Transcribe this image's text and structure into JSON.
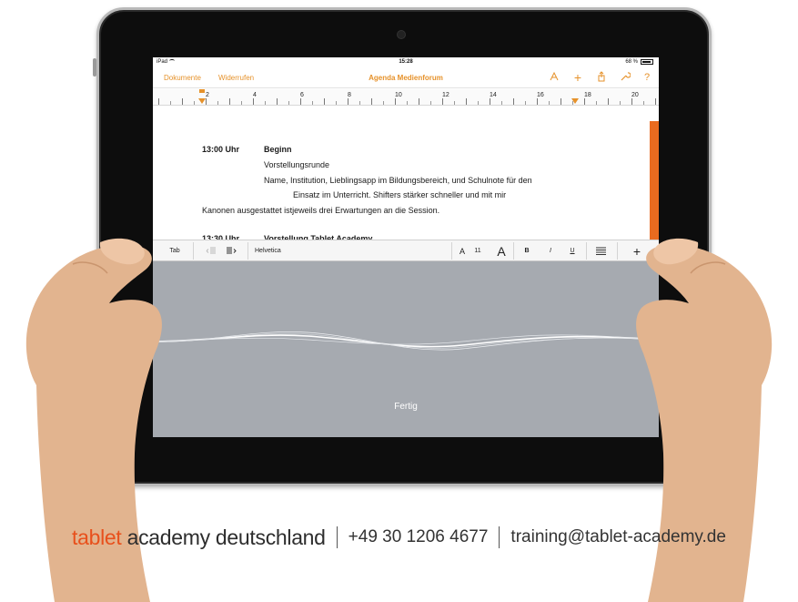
{
  "status": {
    "device": "iPad",
    "time": "15:28",
    "battery": "68 %"
  },
  "nav": {
    "documents": "Dokumente",
    "undo": "Widerrufen",
    "title": "Agenda Medienforum",
    "icons": [
      "brush-icon",
      "plus-icon",
      "share-icon",
      "wrench-icon",
      "help-icon"
    ],
    "help_glyph": "?",
    "plus_glyph": "+"
  },
  "ruler": {
    "numbers": [
      "2",
      "4",
      "6",
      "8",
      "10",
      "12",
      "14",
      "16",
      "18",
      "20"
    ]
  },
  "document": {
    "time1": "13:00 Uhr",
    "heading1": "Beginn",
    "line1": "Vorstellungsrunde",
    "line2": "Name, Institution, Lieblingsapp im Bildungsbereich, und Schulnote für den",
    "line3": "Einsatz im Unterricht. Shifters stärker schneller und mit mir",
    "line4": "Kanonen ausgestattet istjeweils drei Erwartungen an die Session.",
    "time2": "13:30 Uhr",
    "heading2": "Vorstellung Tablet Academy"
  },
  "format_bar": {
    "tab": "Tab",
    "font": "Helvetica",
    "font_small": "A",
    "font_size": "11",
    "font_large": "A",
    "bold": "B",
    "italic": "I",
    "underline": "U",
    "plus": "+"
  },
  "dictation": {
    "done": "Fertig"
  },
  "footer": {
    "brand_accent": "tablet",
    "brand_main": "academy deutschland",
    "phone": "+49 30 1206 4677",
    "email": "training@tablet-academy.de"
  },
  "colors": {
    "accent": "#e6922b",
    "brand": "#e8501c",
    "dictation_bg": "#a6aab0"
  }
}
